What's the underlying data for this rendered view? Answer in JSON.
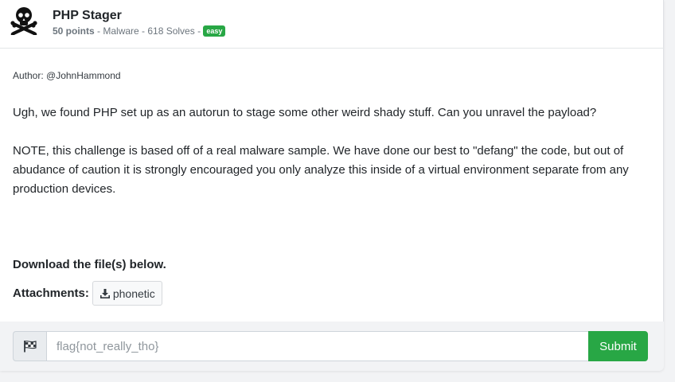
{
  "challenge": {
    "title": "PHP Stager",
    "points": "50 points",
    "category_solves": " - Malware - 618 Solves - ",
    "difficulty": "easy",
    "icon": "skull-crossbones-icon"
  },
  "body": {
    "author": "Author: @JohnHammond",
    "description": "Ugh, we found PHP set up as an autorun to stage some other weird shady stuff. Can you unravel the payload?",
    "note": "NOTE, this challenge is based off of a real malware sample. We have done our best to \"defang\" the code, but out of abudance of caution it is strongly encouraged you only analyze this inside of a virtual environment separate from any production devices."
  },
  "download": {
    "heading": "Download the file(s) below.",
    "attachments_label": "Attachments:",
    "file_name": "phonetic",
    "file_icon": "download-icon"
  },
  "flag_form": {
    "flag_icon": "checkered-flag-icon",
    "placeholder": "flag{not_really_tho}",
    "value": "",
    "submit_label": "Submit"
  },
  "colors": {
    "accent": "#28a745",
    "background": "#f2f3f5"
  }
}
